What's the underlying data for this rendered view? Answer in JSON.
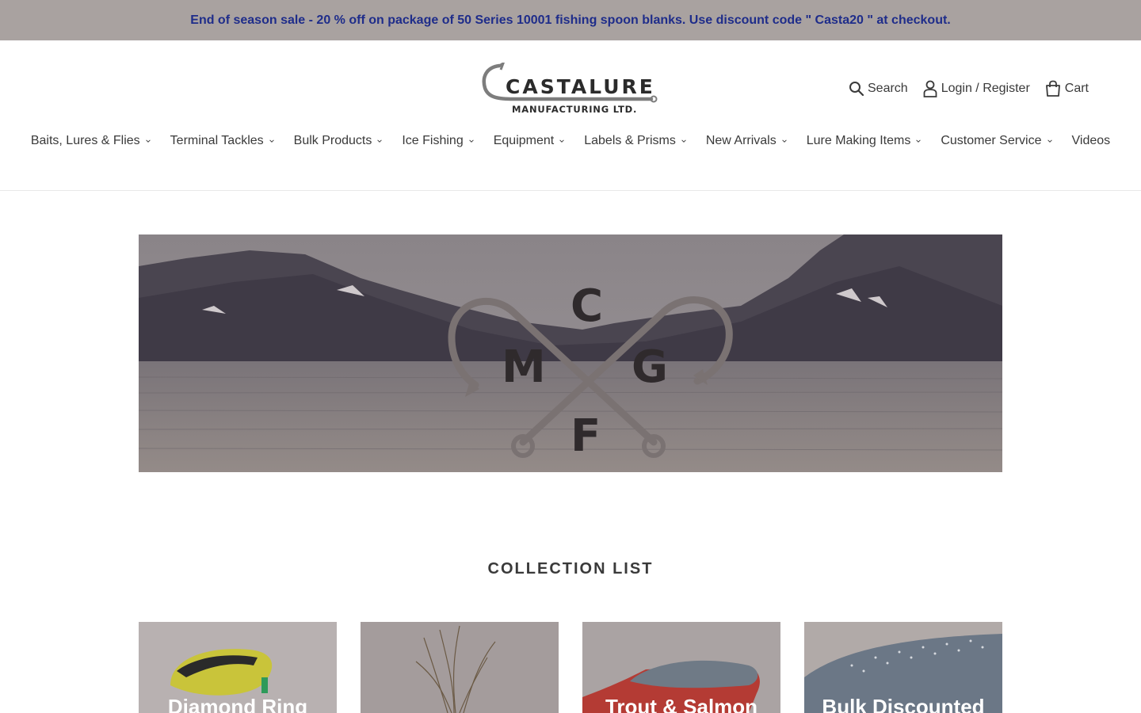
{
  "announcement": {
    "text": "End of season sale - 20 % off on package of 50 Series 10001 fishing spoon blanks. Use discount code \" Casta20 \" at checkout."
  },
  "logo": {
    "name": "CASTALURE",
    "subtitle": "MANUFACTURING LTD."
  },
  "header_links": {
    "search": "Search",
    "login": "Login / Register",
    "cart": "Cart"
  },
  "nav": [
    {
      "label": "Baits, Lures & Flies",
      "has_dropdown": true
    },
    {
      "label": "Terminal Tackles",
      "has_dropdown": true
    },
    {
      "label": "Bulk Products",
      "has_dropdown": true
    },
    {
      "label": "Ice Fishing",
      "has_dropdown": true
    },
    {
      "label": "Equipment",
      "has_dropdown": true
    },
    {
      "label": "Labels & Prisms",
      "has_dropdown": true
    },
    {
      "label": "New Arrivals",
      "has_dropdown": true
    },
    {
      "label": "Lure Making Items",
      "has_dropdown": true
    },
    {
      "label": "Customer Service",
      "has_dropdown": true
    },
    {
      "label": "Videos",
      "has_dropdown": false
    }
  ],
  "hero": {
    "monogram": {
      "top": "C",
      "left": "M",
      "right": "G",
      "bottom": "F"
    }
  },
  "collections": {
    "title": "COLLECTION LIST",
    "items": [
      {
        "label": "Diamond Ring"
      },
      {
        "label": ""
      },
      {
        "label": "Trout & Salmon"
      },
      {
        "label": "Bulk Discounted"
      }
    ]
  },
  "colors": {
    "announcement_bg": "#a9a2a0",
    "announcement_text": "#1f2d8a",
    "body_text": "#3a3a3a"
  },
  "icons": [
    "search-icon",
    "user-icon",
    "cart-icon",
    "chevron-down-icon"
  ]
}
